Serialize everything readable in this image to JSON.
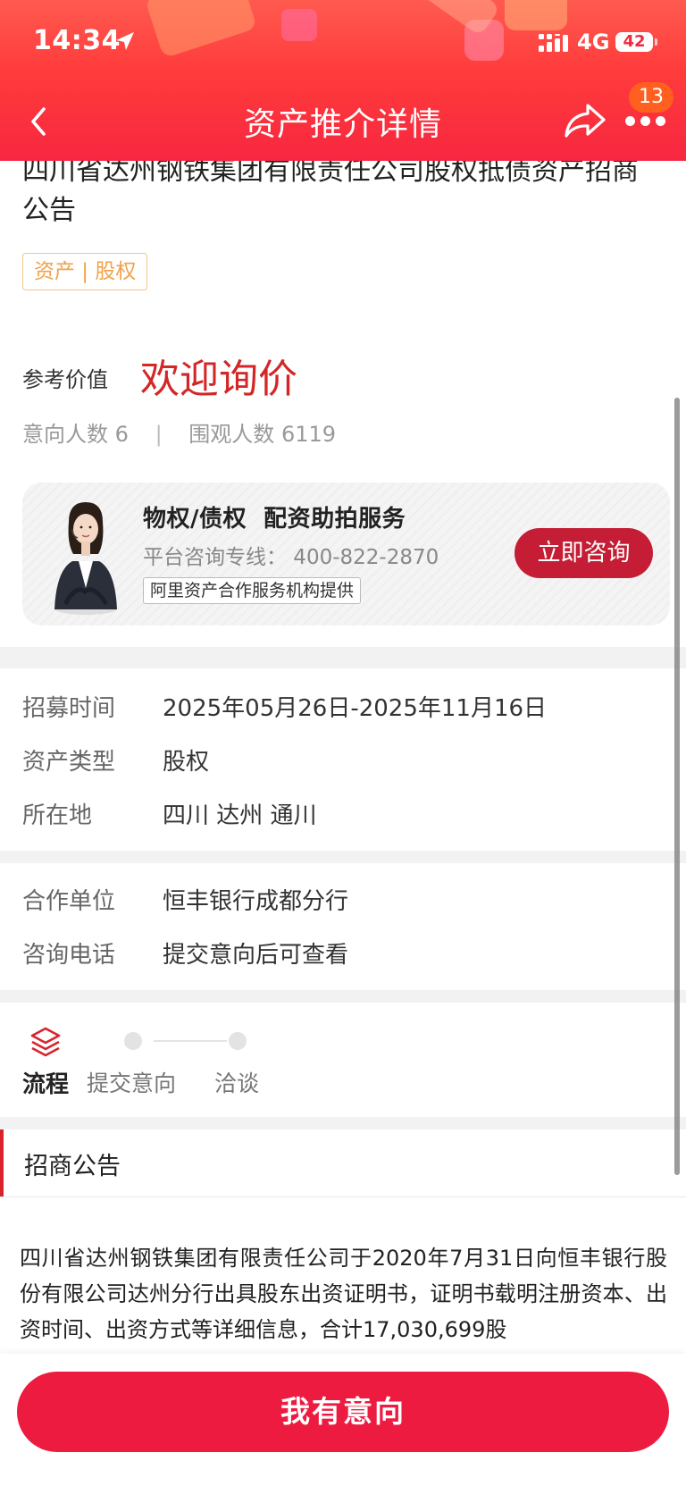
{
  "status_bar": {
    "time": "14:34",
    "network": "4G",
    "battery": "42"
  },
  "nav": {
    "title": "资产推介详情",
    "badge_count": "13"
  },
  "asset": {
    "title": "四川省达州钢铁集团有限责任公司股权抵债资产招商公告",
    "tag": "资产 | 股权",
    "ref_label": "参考价值",
    "ref_value": "欢迎询价",
    "intent_label": "意向人数",
    "intent_count": "6",
    "views_label": "围观人数",
    "views_count": "6119",
    "separator": "|"
  },
  "consult_card": {
    "title": "物权/债权  配资助拍服务",
    "hotline": "平台咨询专线： 400-822-2870",
    "provider": "阿里资产合作服务机构提供",
    "button": "立即咨询"
  },
  "details_1": [
    {
      "label": "招募时间",
      "value": "2025年05月26日-2025年11月16日"
    },
    {
      "label": "资产类型",
      "value": "股权"
    },
    {
      "label": "所在地",
      "value": "四川 达州 通川"
    }
  ],
  "details_2": [
    {
      "label": "合作单位",
      "value": "恒丰银行成都分行"
    },
    {
      "label": "咨询电话",
      "value": "提交意向后可查看"
    }
  ],
  "process": {
    "label": "流程",
    "steps": [
      "提交意向",
      "洽谈"
    ]
  },
  "notice": {
    "title": "招商公告",
    "body": "四川省达州钢铁集团有限责任公司于2020年7月31日向恒丰银行股份有限公司达州分行出具股东出资证明书，证明书载明注册资本、出资时间、出资方式等详细信息，合计17,030,699股"
  },
  "cta": {
    "label": "我有意向"
  },
  "colors": {
    "brand_red": "#ee1b41",
    "price_red": "#d32626",
    "consult_red": "#c41d35",
    "tag_orange": "#f0a24a",
    "badge_orange": "#ff5f1f"
  },
  "icons": [
    "location-arrow-icon",
    "signal-icon",
    "back-arrow-icon",
    "share-icon",
    "more-icon",
    "layers-icon"
  ]
}
